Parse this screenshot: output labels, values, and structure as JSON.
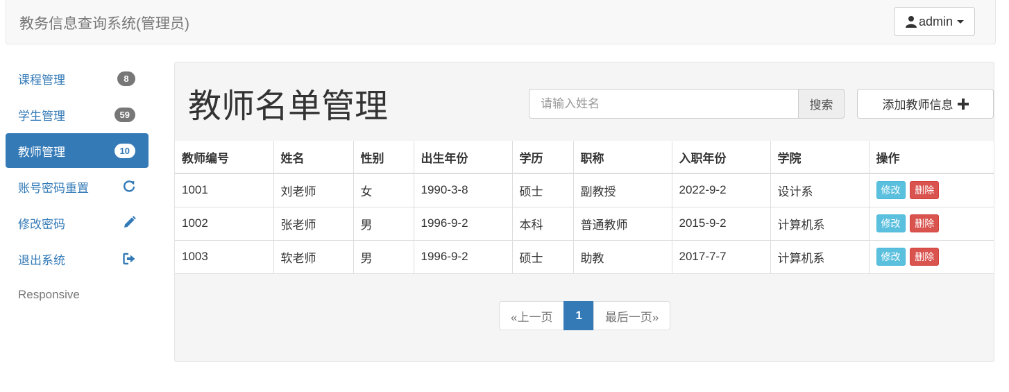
{
  "header": {
    "brand": "教务信息查询系统(管理员)",
    "user_label": "admin"
  },
  "sidebar": {
    "items": [
      {
        "label": "课程管理",
        "badge": "8"
      },
      {
        "label": "学生管理",
        "badge": "59"
      },
      {
        "label": "教师管理",
        "badge": "10"
      },
      {
        "label": "账号密码重置",
        "icon": "refresh-icon"
      },
      {
        "label": "修改密码",
        "icon": "pencil-icon"
      },
      {
        "label": "退出系统",
        "icon": "log-out-icon"
      }
    ],
    "footer_text": "Responsive"
  },
  "main": {
    "title": "教师名单管理",
    "search": {
      "placeholder": "请输入姓名",
      "button_label": "搜索"
    },
    "add_button_label": "添加教师信息",
    "table": {
      "headers": [
        "教师编号",
        "姓名",
        "性别",
        "出生年份",
        "学历",
        "职称",
        "入职年份",
        "学院",
        "操作"
      ],
      "rows": [
        [
          "1001",
          "刘老师",
          "女",
          "1990-3-8",
          "硕士",
          "副教授",
          "2022-9-2",
          "设计系"
        ],
        [
          "1002",
          "张老师",
          "男",
          "1996-9-2",
          "本科",
          "普通教师",
          "2015-9-2",
          "计算机系"
        ],
        [
          "1003",
          "软老师",
          "男",
          "1996-9-2",
          "硕士",
          "助教",
          "2017-7-7",
          "计算机系"
        ]
      ],
      "edit_label": "修改",
      "delete_label": "删除"
    },
    "pagination": {
      "prev": "«上一页",
      "current": "1",
      "last": "最后一页»"
    }
  },
  "colors": {
    "primary": "#337ab7",
    "info": "#5bc0de",
    "danger": "#d9534f"
  }
}
